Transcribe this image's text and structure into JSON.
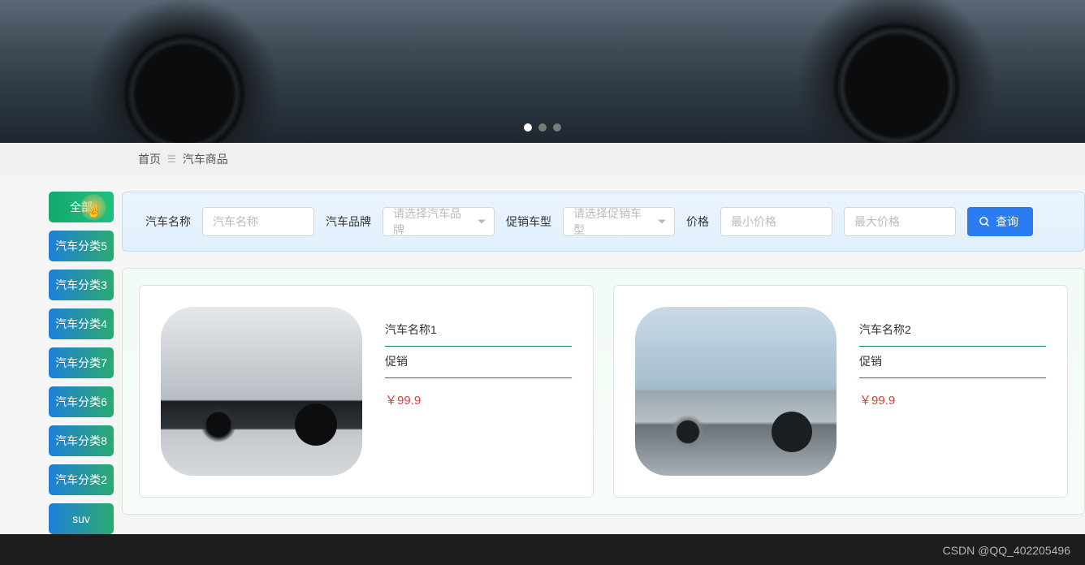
{
  "breadcrumb": {
    "home": "首页",
    "current": "汽车商品"
  },
  "sidebar": {
    "items": [
      {
        "label": "全部",
        "active": true
      },
      {
        "label": "汽车分类5"
      },
      {
        "label": "汽车分类3"
      },
      {
        "label": "汽车分类4"
      },
      {
        "label": "汽车分类7"
      },
      {
        "label": "汽车分类6"
      },
      {
        "label": "汽车分类8"
      },
      {
        "label": "汽车分类2"
      },
      {
        "label": "suv"
      }
    ]
  },
  "filter": {
    "name_label": "汽车名称",
    "name_placeholder": "汽车名称",
    "brand_label": "汽车品牌",
    "brand_placeholder": "请选择汽车品牌",
    "promo_label": "促销车型",
    "promo_placeholder": "请选择促销车型",
    "price_label": "价格",
    "min_price_placeholder": "最小价格",
    "max_price_placeholder": "最大价格",
    "query_btn": "查询"
  },
  "products": [
    {
      "name": "汽车名称1",
      "tag": "促销",
      "price": "￥99.9"
    },
    {
      "name": "汽车名称2",
      "tag": "促销",
      "price": "￥99.9"
    }
  ],
  "watermark": "CSDN @QQ_402205496"
}
